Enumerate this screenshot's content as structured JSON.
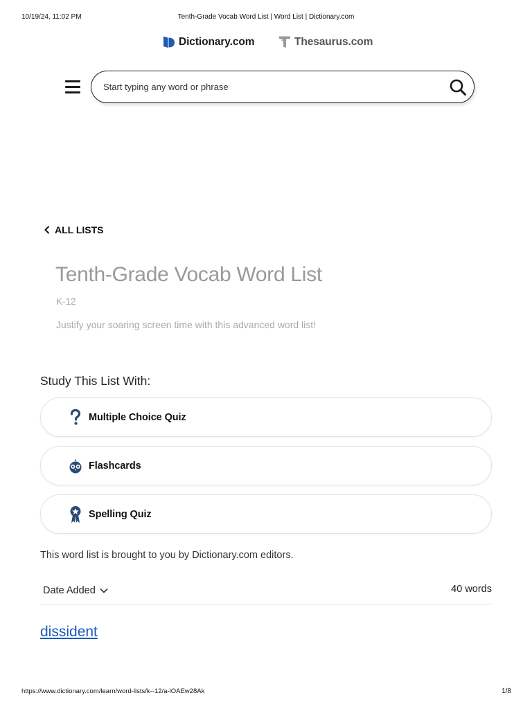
{
  "print": {
    "datetime": "10/19/24, 11:02 PM",
    "title": "Tenth-Grade Vocab Word List | Word List | Dictionary.com",
    "url": "https://www.dictionary.com/learn/word-lists/k--12/a-lOAEw28Ak",
    "page": "1/8"
  },
  "brands": {
    "dictionary": "Dictionary.com",
    "thesaurus": "Thesaurus.com"
  },
  "search": {
    "placeholder": "Start typing any word or phrase",
    "value": ""
  },
  "nav": {
    "back_label": "ALL LISTS"
  },
  "list": {
    "title": "Tenth-Grade Vocab Word List",
    "grade": "K-12",
    "description": "Justify your soaring screen time with this advanced word list!"
  },
  "study": {
    "heading": "Study This List With:",
    "options": [
      {
        "label": "Multiple Choice Quiz",
        "icon": "question-mark-icon"
      },
      {
        "label": "Flashcards",
        "icon": "owl-icon"
      },
      {
        "label": "Spelling Quiz",
        "icon": "ribbon-badge-icon"
      }
    ]
  },
  "credit": "This word list is brought to you by Dictionary.com editors.",
  "sort": {
    "selected": "Date Added",
    "count": "40 words"
  },
  "words": [
    "dissident"
  ],
  "colors": {
    "brand_blue": "#1e5ab0",
    "icon_navy": "#2b4a73",
    "link_blue": "#1b5bb5"
  }
}
